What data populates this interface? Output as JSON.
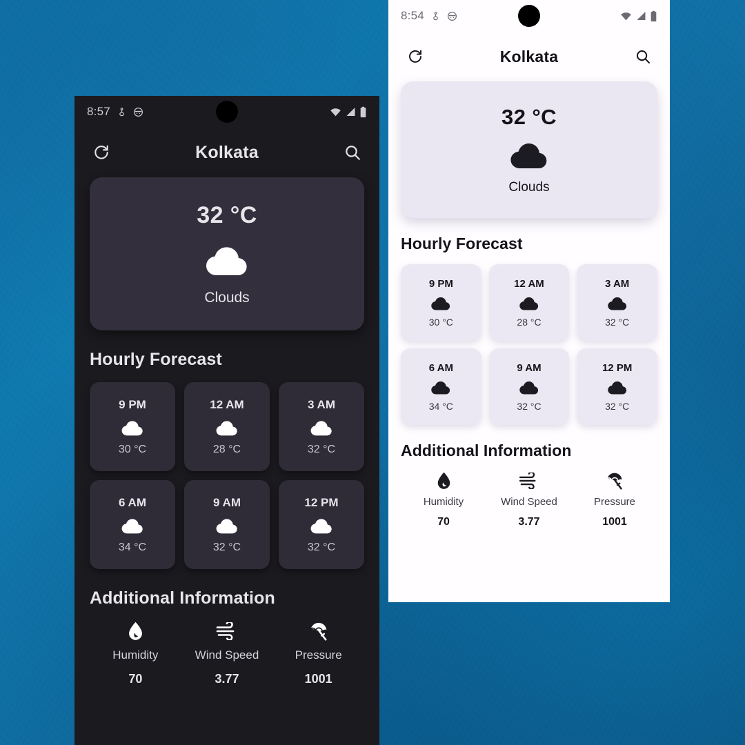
{
  "wallpaper": {
    "color": "#0f6fa4"
  },
  "phones": [
    {
      "theme": "dark",
      "colors": {
        "background": "#1b1a1f",
        "card": "#332f3c",
        "hour_card": "#2f2c38",
        "text": "#e7e4ea"
      },
      "status_bar": {
        "time": "8:57",
        "left_icons": [
          "location-icon",
          "face-icon"
        ],
        "right_icons": [
          "wifi-icon",
          "signal-icon",
          "battery-icon"
        ]
      },
      "app_bar": {
        "refresh_icon": "refresh-icon",
        "title": "Kolkata",
        "search_icon": "search-icon"
      },
      "current": {
        "temperature": "32 °C",
        "weather_icon": "cloud-icon",
        "description": "Clouds"
      },
      "hourly": {
        "title": "Hourly Forecast",
        "items": [
          {
            "time": "9 PM",
            "icon": "cloud-icon",
            "temp": "30 °C"
          },
          {
            "time": "12 AM",
            "icon": "cloud-icon",
            "temp": "28 °C"
          },
          {
            "time": "3 AM",
            "icon": "cloud-icon",
            "temp": "32 °C"
          },
          {
            "time": "6 AM",
            "icon": "cloud-icon",
            "temp": "34 °C"
          },
          {
            "time": "9 AM",
            "icon": "cloud-icon",
            "temp": "32 °C"
          },
          {
            "time": "12 PM",
            "icon": "cloud-icon",
            "temp": "32 °C"
          }
        ]
      },
      "additional": {
        "title": "Additional Information",
        "items": [
          {
            "icon": "water-drop-icon",
            "label": "Humidity",
            "value": "70"
          },
          {
            "icon": "wind-icon",
            "label": "Wind Speed",
            "value": "3.77"
          },
          {
            "icon": "beach-umbrella-icon",
            "label": "Pressure",
            "value": "1001"
          }
        ]
      }
    },
    {
      "theme": "light",
      "colors": {
        "background": "#fffdff",
        "card": "#eae6f2",
        "hour_card": "#ece8f3",
        "text": "#15131a"
      },
      "status_bar": {
        "time": "8:54",
        "left_icons": [
          "location-icon",
          "face-icon"
        ],
        "right_icons": [
          "wifi-icon",
          "signal-icon",
          "battery-icon"
        ]
      },
      "app_bar": {
        "refresh_icon": "refresh-icon",
        "title": "Kolkata",
        "search_icon": "search-icon"
      },
      "current": {
        "temperature": "32 °C",
        "weather_icon": "cloud-icon",
        "description": "Clouds"
      },
      "hourly": {
        "title": "Hourly Forecast",
        "items": [
          {
            "time": "9 PM",
            "icon": "cloud-icon",
            "temp": "30 °C"
          },
          {
            "time": "12 AM",
            "icon": "cloud-icon",
            "temp": "28 °C"
          },
          {
            "time": "3 AM",
            "icon": "cloud-icon",
            "temp": "32 °C"
          },
          {
            "time": "6 AM",
            "icon": "cloud-icon",
            "temp": "34 °C"
          },
          {
            "time": "9 AM",
            "icon": "cloud-icon",
            "temp": "32 °C"
          },
          {
            "time": "12 PM",
            "icon": "cloud-icon",
            "temp": "32 °C"
          }
        ]
      },
      "additional": {
        "title": "Additional Information",
        "items": [
          {
            "icon": "water-drop-icon",
            "label": "Humidity",
            "value": "70"
          },
          {
            "icon": "wind-icon",
            "label": "Wind Speed",
            "value": "3.77"
          },
          {
            "icon": "beach-umbrella-icon",
            "label": "Pressure",
            "value": "1001"
          }
        ]
      }
    }
  ]
}
